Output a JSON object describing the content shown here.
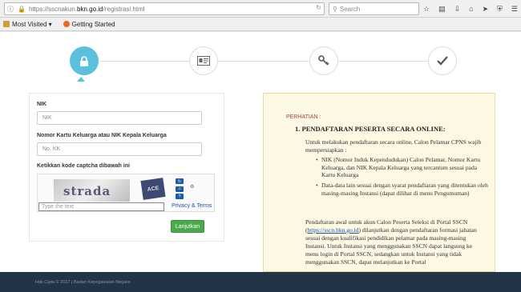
{
  "browser": {
    "url_prefix": "https://sscnakun.",
    "url_domain": "bkn.go.id",
    "url_path": "/registrasi.html",
    "search_placeholder": "Search",
    "bookmarks": [
      {
        "label": "Most Visited ▾"
      },
      {
        "label": "Getting Started"
      }
    ]
  },
  "form": {
    "nik_label": "NIK",
    "nik_placeholder": "NIK",
    "kk_label": "Nomor Kartu Keluarga atau NIK Kepala Keluarga",
    "kk_placeholder": "No. KK",
    "captcha_label": "Ketikkan kode captcha dibawah ini",
    "captcha_word": "strada",
    "captcha_word2": "ACE",
    "captcha_input_placeholder": "Type the text",
    "privacy_link": "Privacy & Terms",
    "next_button": "Lanjutkan"
  },
  "info": {
    "heading": "PERHATIAN :",
    "item1_title": "1. PENDAFTARAN PESERTA SECARA ONLINE:",
    "intro": "Untuk melakukan pendaftaran secara online, Calon Pelamar CPNS wajib mempersiapkan :",
    "bullets": [
      "NIK (Nomor Induk Kependudukan) Calon Pelamar, Nomor Kartu Keluarga, dan NIK Kepala Keluarga yang tercantum sesuai pada Kartu Keluarga",
      "Data-data lain sesuai dengan syarat pendaftaran yang ditentukan oleh masing-masing Instansi (dapat dilihat di menu Pengumuman)"
    ],
    "para2_a": "Pendaftaran awal untuk akun Calon Peserta Seleksi di Portal SSCN (",
    "para2_link": "https://sscn.bkn.go.id",
    "para2_b": ") dilanjutkan dengan pendaftaran formasi jabatan sesuai dengan kualifikasi pendidikan pelamar pada masing-masing Instansi. Untuk Instansi yang menggunakan SSCN dapat langsung ke menu login di Portal SSCN, sedangkan untuk Instansi yang tidak menggunakan SSCN, dapat melanjutkan ke Portal"
  },
  "footer": {
    "text": "Hak Cipta © 2017 | Badan Kepegawaian Negara"
  }
}
